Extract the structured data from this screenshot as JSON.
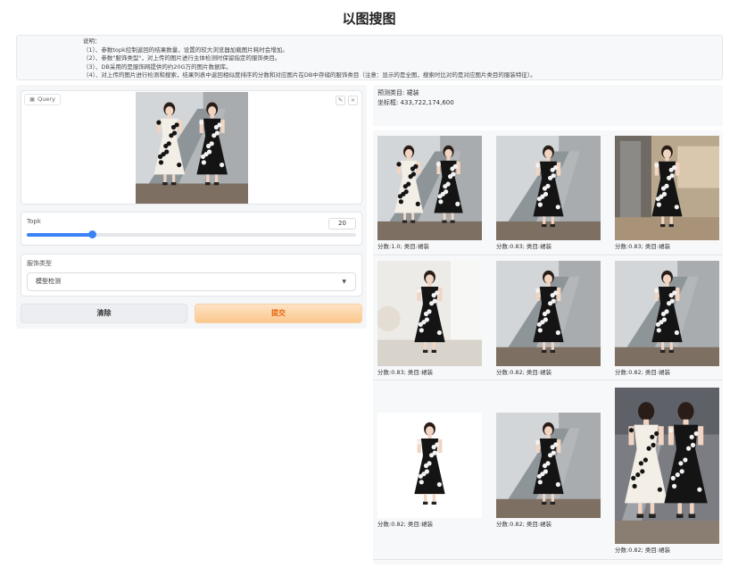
{
  "page": {
    "title": "以图搜图"
  },
  "description": {
    "lines": [
      "说明：",
      "（1）、参数topk控制返回的结果数量，设置的较大浏览器加载图片耗时会增加。",
      "（2）、参数\"服饰类型\"，对上传的图片进行主体检测时保留指定的服饰类目。",
      "（3）、DB采用的是服饰网提供的约20G万的图片数据库。",
      "（4）、对上传的图片进行检测和搜索，结果列表中返回相似度排序的分数和对应图片在DB中存储的服饰类目（注意：显示的是全图，搜索时比对的是对应图片类目的服装特征）。"
    ]
  },
  "query": {
    "label": "Query",
    "label_icon": "image-icon",
    "edit_icon": "pencil-icon",
    "close_icon": "close-icon"
  },
  "topk": {
    "label": "Topk",
    "value": "20",
    "fraction": 0.2
  },
  "clothing_type": {
    "label": "服饰类型",
    "selected": "模型检测"
  },
  "buttons": {
    "clear": "清除",
    "submit": "提交"
  },
  "prediction": {
    "category": "预测类目: 裙装",
    "coords": "坐标框: 433,722,174,600"
  },
  "results": [
    {
      "caption": "分数:1.0; 类目:裙装",
      "scene": "escalator-pair"
    },
    {
      "caption": "分数:0.83; 类目:裙装",
      "scene": "escalator"
    },
    {
      "caption": "分数:0.83; 类目:裙装",
      "scene": "mall"
    },
    {
      "caption": "分数:0.83; 类目:裙装",
      "scene": "indoor-hat"
    },
    {
      "caption": "分数:0.82; 类目:裙装",
      "scene": "escalator"
    },
    {
      "caption": "分数:0.82; 类目:裙装",
      "scene": "escalator"
    },
    {
      "caption": "分数:0.82; 类目:裙装",
      "scene": "white"
    },
    {
      "caption": "分数:0.82; 类目:裙装",
      "scene": "escalator"
    },
    {
      "caption": "分数:0.82; 类目:裙装",
      "scene": "escalator-pair-back"
    }
  ],
  "colors": {
    "accent": "#3b82f6",
    "submit_text": "#e8630a",
    "dress": "#141414",
    "dot": "#f2f2f2"
  }
}
